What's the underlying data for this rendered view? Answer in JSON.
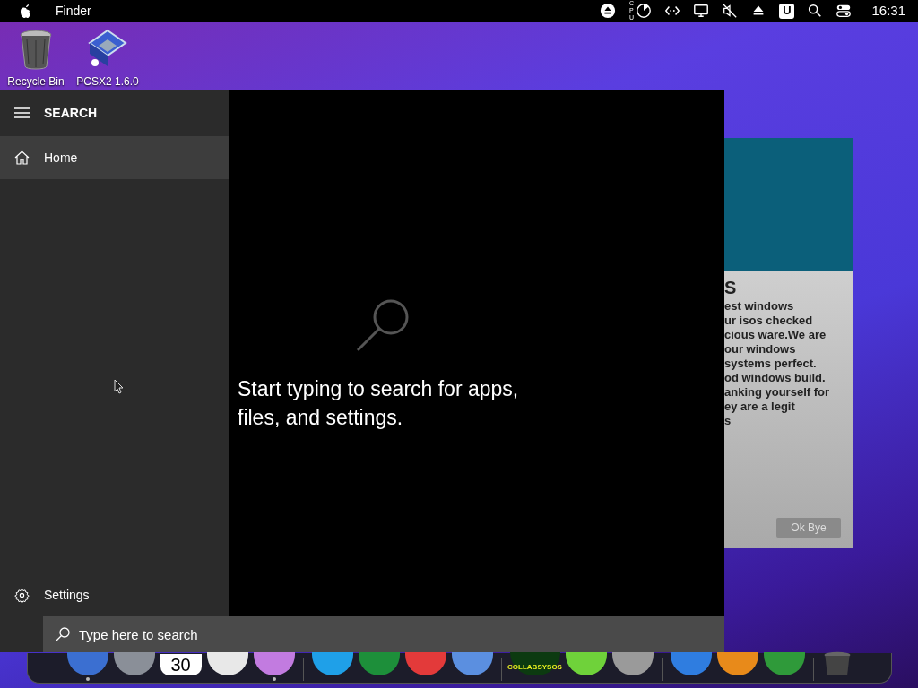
{
  "menu_bar": {
    "app_name": "Finder",
    "cpu_label": "CPU",
    "u_badge": "U",
    "time": "16:31"
  },
  "desktop_icons": [
    {
      "kind": "bin",
      "label": "Recycle Bin"
    },
    {
      "kind": "pcsx2",
      "label": "PCSX2 1.6.0"
    }
  ],
  "background_dialog": {
    "heading": "S",
    "lines": [
      "est windows",
      "ur isos checked",
      "cious ware.We are",
      "our windows",
      "systems perfect.",
      "od windows build.",
      "anking yourself for",
      "ey are a legit",
      "s"
    ],
    "button": "Ok Bye"
  },
  "search_panel": {
    "title": "SEARCH",
    "nav": [
      {
        "label": "Home",
        "selected": true
      }
    ],
    "settings": "Settings",
    "empty_message": "Start typing to search for apps, files, and settings.",
    "search_box": {
      "placeholder": "Type here to search"
    }
  },
  "dock": {
    "items": [
      {
        "kind": "app",
        "color": "#3b6fd1",
        "running": true
      },
      {
        "kind": "app",
        "color": "#8a8f98",
        "running": false
      },
      {
        "kind": "calendar",
        "label": "30",
        "running": false
      },
      {
        "kind": "app",
        "color": "#e8e8e8",
        "running": false
      },
      {
        "kind": "app",
        "color": "#c27be0",
        "running": true
      },
      {
        "kind": "divider"
      },
      {
        "kind": "app",
        "color": "#1fa0e8",
        "running": false
      },
      {
        "kind": "app",
        "color": "#1d8f3a",
        "running": false
      },
      {
        "kind": "app",
        "color": "#e33a3a",
        "running": false
      },
      {
        "kind": "app",
        "color": "#5b8fe0",
        "running": false
      },
      {
        "kind": "divider"
      },
      {
        "kind": "badge",
        "label": "COLLABSYSOS",
        "running": false
      },
      {
        "kind": "app",
        "color": "#6fd23a",
        "running": false
      },
      {
        "kind": "app",
        "color": "#9a9a9a",
        "running": false
      },
      {
        "kind": "divider"
      },
      {
        "kind": "app",
        "color": "#2f7de0",
        "running": false
      },
      {
        "kind": "app",
        "color": "#e88a1a",
        "running": false
      },
      {
        "kind": "app",
        "color": "#2f9a3a",
        "running": false
      },
      {
        "kind": "divider"
      },
      {
        "kind": "trash",
        "running": false
      }
    ]
  }
}
